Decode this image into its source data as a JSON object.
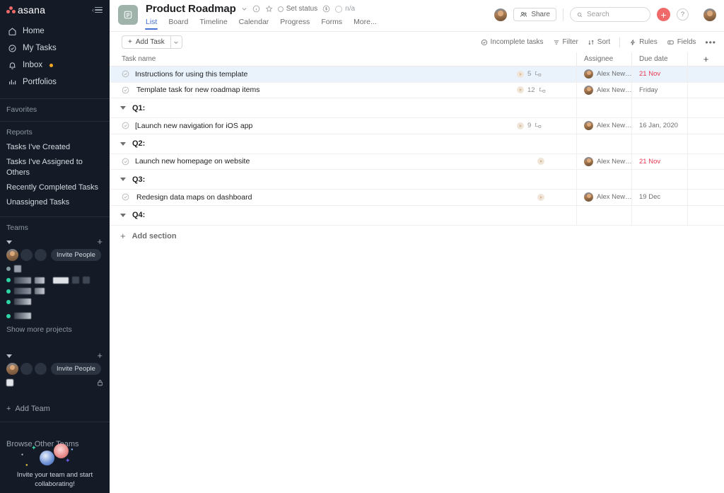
{
  "sidebar": {
    "logo_text": "asana",
    "collapse_label": "collapse-sidebar",
    "nav": [
      {
        "label": "Home",
        "icon": "home-icon"
      },
      {
        "label": "My Tasks",
        "icon": "check-circle-icon"
      },
      {
        "label": "Inbox",
        "icon": "bell-icon",
        "dot": true
      },
      {
        "label": "Portfolios",
        "icon": "bar-chart-icon"
      }
    ],
    "favorites_label": "Favorites",
    "reports_label": "Reports",
    "reports": [
      "Tasks I've Created",
      "Tasks I've Assigned to Others",
      "Recently Completed Tasks",
      "Unassigned Tasks"
    ],
    "teams_label": "Teams",
    "invite_people_label": "Invite People",
    "show_more_label": "Show more projects",
    "add_team_label": "Add Team",
    "browse_other_teams_label": "Browse Other Teams",
    "invite_illustration_text": "Invite your team and start collaborating!",
    "team1_projects": [
      {
        "dot": "#7f9aa0",
        "chips": []
      },
      {
        "dot": "#2fd6a5",
        "chips": [
          36,
          22,
          24,
          10,
          10
        ]
      },
      {
        "dot": "#2fd6a5",
        "chips": [
          29,
          17
        ]
      },
      {
        "dot": "#2fd6a5",
        "chips": [
          26
        ]
      },
      {
        "dot": "#2fd6a5",
        "chips": [
          26
        ]
      }
    ],
    "team2_projects": [
      {
        "dot": "#d8dbe0",
        "chips": [],
        "lock": true
      }
    ]
  },
  "header": {
    "project_title": "Product Roadmap",
    "project_icon": "list-project-icon",
    "caret_icon": "chevron-down-icon",
    "info_icon": "info-icon",
    "star_icon": "star-icon",
    "set_status_label": "Set status",
    "currency_icon": "dollar-circle-icon",
    "na_label": "n/a",
    "tabs": [
      {
        "label": "List",
        "active": true
      },
      {
        "label": "Board",
        "active": false
      },
      {
        "label": "Timeline",
        "active": false
      },
      {
        "label": "Calendar",
        "active": false
      },
      {
        "label": "Progress",
        "active": false
      },
      {
        "label": "Forms",
        "active": false
      },
      {
        "label": "More...",
        "active": false
      }
    ],
    "share_label": "Share",
    "search_placeholder": "Search",
    "search_value": "",
    "plus_label": "+",
    "help_label": "?",
    "accent_color": "#4573d2",
    "brand_color": "#f06a6a"
  },
  "toolbar": {
    "add_task_label": "Add Task",
    "add_task_caret": "chevron-down-icon",
    "incomplete_tasks_label": "Incomplete tasks",
    "filter_label": "Filter",
    "sort_label": "Sort",
    "rules_label": "Rules",
    "fields_label": "Fields",
    "more_label": "•••"
  },
  "table": {
    "columns": {
      "task_name": "Task name",
      "assignee": "Assignee",
      "due_date": "Due date",
      "add_column": "+"
    },
    "rows": [
      {
        "type": "task",
        "name": "Instructions for using this template",
        "selected": true,
        "count": "5",
        "has_meta": true,
        "assignee": "Alex Newnh...",
        "due": "21 Nov",
        "overdue": true
      },
      {
        "type": "task",
        "name": "Template task for new roadmap items",
        "spell_word": "roadmap",
        "selected": false,
        "count": "12",
        "has_meta": true,
        "assignee": "Alex Newnh...",
        "due": "Friday",
        "overdue": false
      },
      {
        "type": "section",
        "name": "Q1:"
      },
      {
        "type": "task",
        "name": "[Launch new navigation for iOS app",
        "spell_word": "iOS",
        "selected": false,
        "count": "9",
        "has_meta": true,
        "assignee": "Alex Newnh...",
        "due": "16 Jan, 2020",
        "overdue": false
      },
      {
        "type": "section",
        "name": "Q2:"
      },
      {
        "type": "task",
        "name": "Launch new homepage on website",
        "selected": false,
        "count": "",
        "has_meta": true,
        "assignee": "Alex Newnh...",
        "due": "21 Nov",
        "overdue": true
      },
      {
        "type": "section",
        "name": "Q3:"
      },
      {
        "type": "task",
        "name": "Redesign data maps on dashboard",
        "selected": false,
        "count": "",
        "has_meta": true,
        "assignee": "Alex Newnh...",
        "due": "19 Dec",
        "overdue": false
      },
      {
        "type": "section",
        "name": "Q4:"
      }
    ],
    "add_section_label": "Add section"
  }
}
